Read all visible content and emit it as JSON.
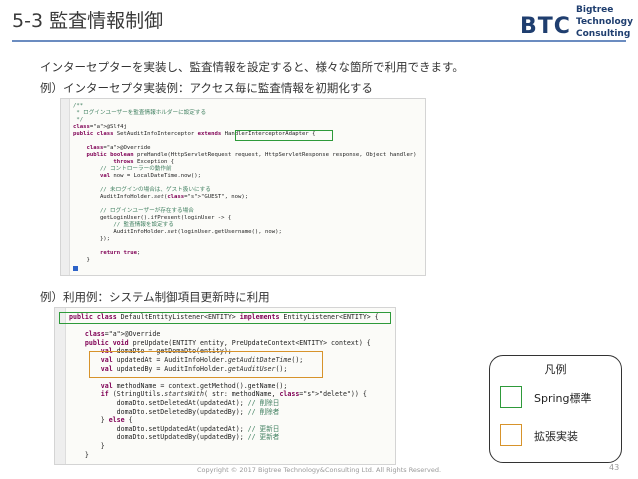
{
  "slide": {
    "title": "5-3 監査情報制御",
    "intro": "インターセプターを実装し、監査情報を設定すると、様々な箇所で利用できます。",
    "example1_heading": "例）インターセプタ実装例：アクセス毎に監査情報を初期化する",
    "example2_heading": "例）利用例：システム制御項目更新時に利用",
    "footer": "Copyright © 2017 Bigtree Technology&Consulting Ltd. All Rights Reserved.",
    "page_number": "43"
  },
  "logo": {
    "mark": "BTC",
    "line1": "Bigtree",
    "line2": "Technology",
    "line3": "Consulting"
  },
  "legend": {
    "title": "凡例",
    "green_label": "Spring標準",
    "orange_label": "拡張実装"
  },
  "colors": {
    "standard": "#2e9a3a",
    "extension": "#d7932b",
    "title_rule": "#6b8cc0"
  },
  "code1": [
    "/**",
    " * ログインユーザーを監査情報ホルダーに設定する",
    " */",
    "@Slf4j",
    "public class SetAuditInfoInterceptor extends HandlerInterceptorAdapter {",
    "",
    "    @Override",
    "    public boolean preHandle(HttpServletRequest request, HttpServletResponse response, Object handler)",
    "            throws Exception {",
    "        // コントローラーの動作前",
    "        val now = LocalDateTime.now();",
    "",
    "        // 未ログインの場合は、ゲスト扱いにする",
    "        AuditInfoHolder.set(\"GUEST\", now);",
    "",
    "        // ログインユーザーが存在する場合",
    "        getLoginUser().ifPresent(loginUser -> {",
    "            // 監査情報を設定する",
    "            AuditInfoHolder.set(loginUser.getUsername(), now);",
    "        });",
    "",
    "        return true;",
    "    }"
  ],
  "code2": [
    "public class DefaultEntityListener<ENTITY> implements EntityListener<ENTITY> {",
    "",
    "    @Override",
    "    public void preUpdate(ENTITY entity, PreUpdateContext<ENTITY> context) {",
    "        val domaDto = getDomaDto(entity);",
    "        val updatedAt = AuditInfoHolder.getAuditDateTime();",
    "        val updatedBy = AuditInfoHolder.getAuditUser();",
    "",
    "        val methodName = context.getMethod().getName();",
    "        if (StringUtils.startsWith( str: methodName, \"delete\")) {",
    "            domaDto.setDeletedAt(updatedAt); // 削除日",
    "            domaDto.setDeletedBy(updatedBy); // 削除者",
    "        } else {",
    "            domaDto.setUpdatedAt(updatedAt); // 更新日",
    "            domaDto.setUpdatedBy(updatedBy); // 更新者",
    "        }",
    "    }"
  ]
}
